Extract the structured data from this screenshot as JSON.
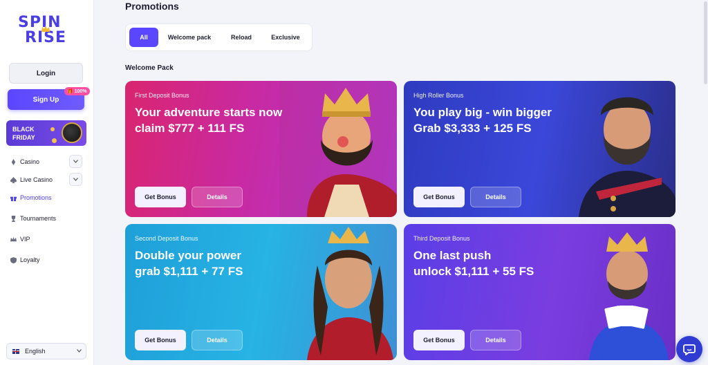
{
  "brand": {
    "logo_line1": "SPIN",
    "logo_line2": "RISE",
    "accent": "#5b46ff"
  },
  "auth": {
    "login_label": "Login",
    "signup_label": "Sign Up",
    "signup_badge": "100%"
  },
  "promo_banner": {
    "line1": "BLACK",
    "line2": "FRIDAY"
  },
  "nav": {
    "items": [
      {
        "label": "Casino",
        "icon": "cards-icon",
        "has_chevron": true
      },
      {
        "label": "Live Casino",
        "icon": "spade-icon",
        "has_chevron": true
      },
      {
        "label": "Promotions",
        "icon": "gift-icon",
        "active": true
      },
      {
        "label": "Tournaments",
        "icon": "trophy-icon"
      },
      {
        "label": "VIP",
        "icon": "crown-icon"
      },
      {
        "label": "Loyalty",
        "icon": "shield-icon"
      }
    ]
  },
  "language": {
    "label": "English"
  },
  "main": {
    "title": "Promotions",
    "tabs": [
      {
        "label": "All",
        "active": true
      },
      {
        "label": "Welcome pack"
      },
      {
        "label": "Reload"
      },
      {
        "label": "Exclusive"
      }
    ],
    "section_title": "Welcome Pack",
    "cards": [
      {
        "subtitle": "First Deposit Bonus",
        "line1": "Your adventure starts now",
        "line2": "claim $777 + 111 FS",
        "get_label": "Get Bonus",
        "details_label": "Details"
      },
      {
        "subtitle": "High Roller Bonus",
        "line1": "You play big - win bigger",
        "line2": "Grab $3,333 + 125 FS",
        "get_label": "Get Bonus",
        "details_label": "Details"
      },
      {
        "subtitle": "Second Deposit Bonus",
        "line1": "Double your power",
        "line2": "grab $1,111 + 77 FS",
        "get_label": "Get Bonus",
        "details_label": "Details"
      },
      {
        "subtitle": "Third Deposit Bonus",
        "line1": "One last push",
        "line2": "unlock $1,111 + 55 FS",
        "get_label": "Get Bonus",
        "details_label": "Details"
      }
    ]
  }
}
